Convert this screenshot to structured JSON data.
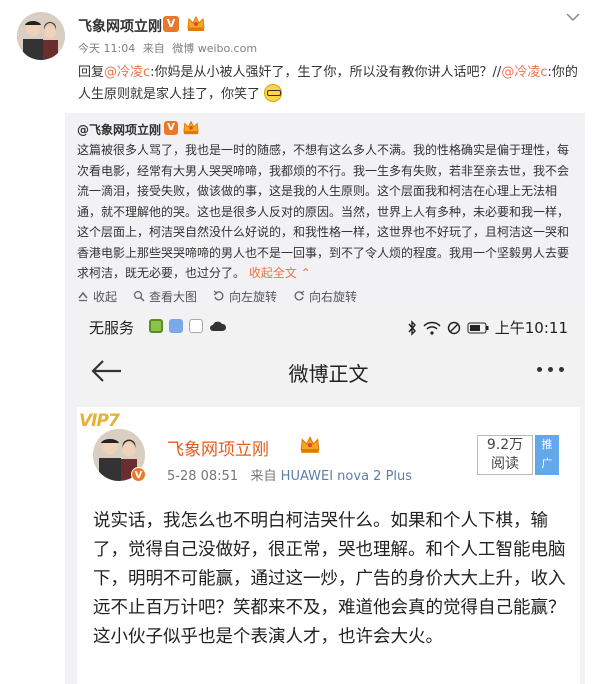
{
  "post": {
    "author": "飞象网项立刚",
    "verified_mark": "V",
    "meta": {
      "time": "今天 11:04",
      "source_prefix": "来自",
      "source": "微博 weibo.com"
    },
    "reply": {
      "prefix": "回复",
      "mention1": "@冷凌c",
      "text1": ":你妈是从小被人强奸了，生了你，所以没有教你讲人话吧？//",
      "mention2": "@冷凌c",
      "text2": ":你的人生原则就是家人挂了，你笑了"
    }
  },
  "repost": {
    "author": "@飞象网项立刚",
    "verified_mark": "V",
    "text": "这篇被很多人骂了，我也是一时的随感，不想有这么多人不满。我的性格确实是偏于理性，每次看电影，经常有大男人哭哭啼啼，我都烦的不行。我一生多有失败，若非至亲去世，我不会流一滴泪，接受失败，做该做的事，这是我的人生原则。这个层面我和柯洁在心理上无法相通，就不理解他的哭。这也是很多人反对的原因。当然，世界上人有多种，未必要和我一样，这个层面上，柯洁哭自然没什么好说的，和我性格一样，这世界也不好玩了，且柯洁这一哭和香港电影上那些哭哭啼啼的男人也不是一回事，到不了令人烦的程度。我用一个坚毅男人去要求柯洁，既无必要，也过分了。",
    "collapse_label": "收起全文 ⌃",
    "actions": [
      {
        "label": "收起",
        "icon": "collapse-up-icon"
      },
      {
        "label": "查看大图",
        "icon": "zoom-in-icon"
      },
      {
        "label": "向左旋转",
        "icon": "rotate-left-icon"
      },
      {
        "label": "向右旋转",
        "icon": "rotate-right-icon"
      }
    ]
  },
  "phone": {
    "status": {
      "carrier": "无服务",
      "time": "上午10:11"
    },
    "title": "微博正文",
    "card": {
      "vip_tag": "VIP7",
      "verified_mark": "V",
      "author": "飞象网项立刚",
      "date": "5-28 08:51",
      "source_prefix": "来自",
      "device": "HUAWEI nova 2 Plus",
      "read_count": "9.2万",
      "read_label": "阅读",
      "promote_top": "推",
      "promote_bottom": "广",
      "text": "说实话，我怎么也不明白柯洁哭什么。如果和个人下棋，输了，觉得自己没做好，很正常，哭也理解。和个人工智能电脑下，明明不可能赢，通过这一炒，广告的身价大大上升，收入远不止百万计吧？笑都来不及，难道他会真的觉得自己能赢？这小伙子似乎也是个表演人才，也许会大火。"
    }
  },
  "colors": {
    "mention": "#eb7350",
    "verified": "#e9792a",
    "repost_bg": "#f2f2f5",
    "card_name": "#e65c1a",
    "promote": "#63a8ea"
  }
}
